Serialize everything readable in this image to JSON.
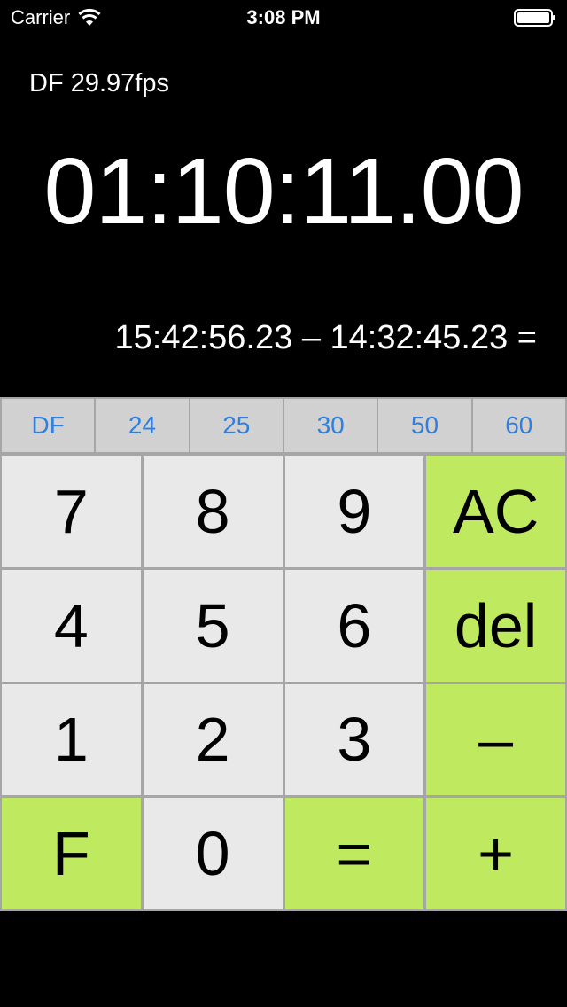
{
  "status_bar": {
    "carrier": "Carrier",
    "time": "3:08 PM",
    "icons": [
      "wifi-icon",
      "battery-icon"
    ]
  },
  "display": {
    "fps_mode": "DF 29.97fps",
    "result": "01:10:11.00",
    "expression": "15:42:56.23 – 14:32:45.23 ="
  },
  "fps_buttons": [
    "DF",
    "24",
    "25",
    "30",
    "50",
    "60"
  ],
  "keys": {
    "k7": "7",
    "k8": "8",
    "k9": "9",
    "ac": "AC",
    "k4": "4",
    "k5": "5",
    "k6": "6",
    "del": "del",
    "k1": "1",
    "k2": "2",
    "k3": "3",
    "minus": "–",
    "f": "F",
    "k0": "0",
    "equals": "=",
    "plus": "+"
  },
  "colors": {
    "background": "#000000",
    "number_key": "#e9e9e9",
    "operator_key": "#bfea60",
    "fps_key": "#d1d1d1",
    "fps_text": "#2e7fe0"
  }
}
